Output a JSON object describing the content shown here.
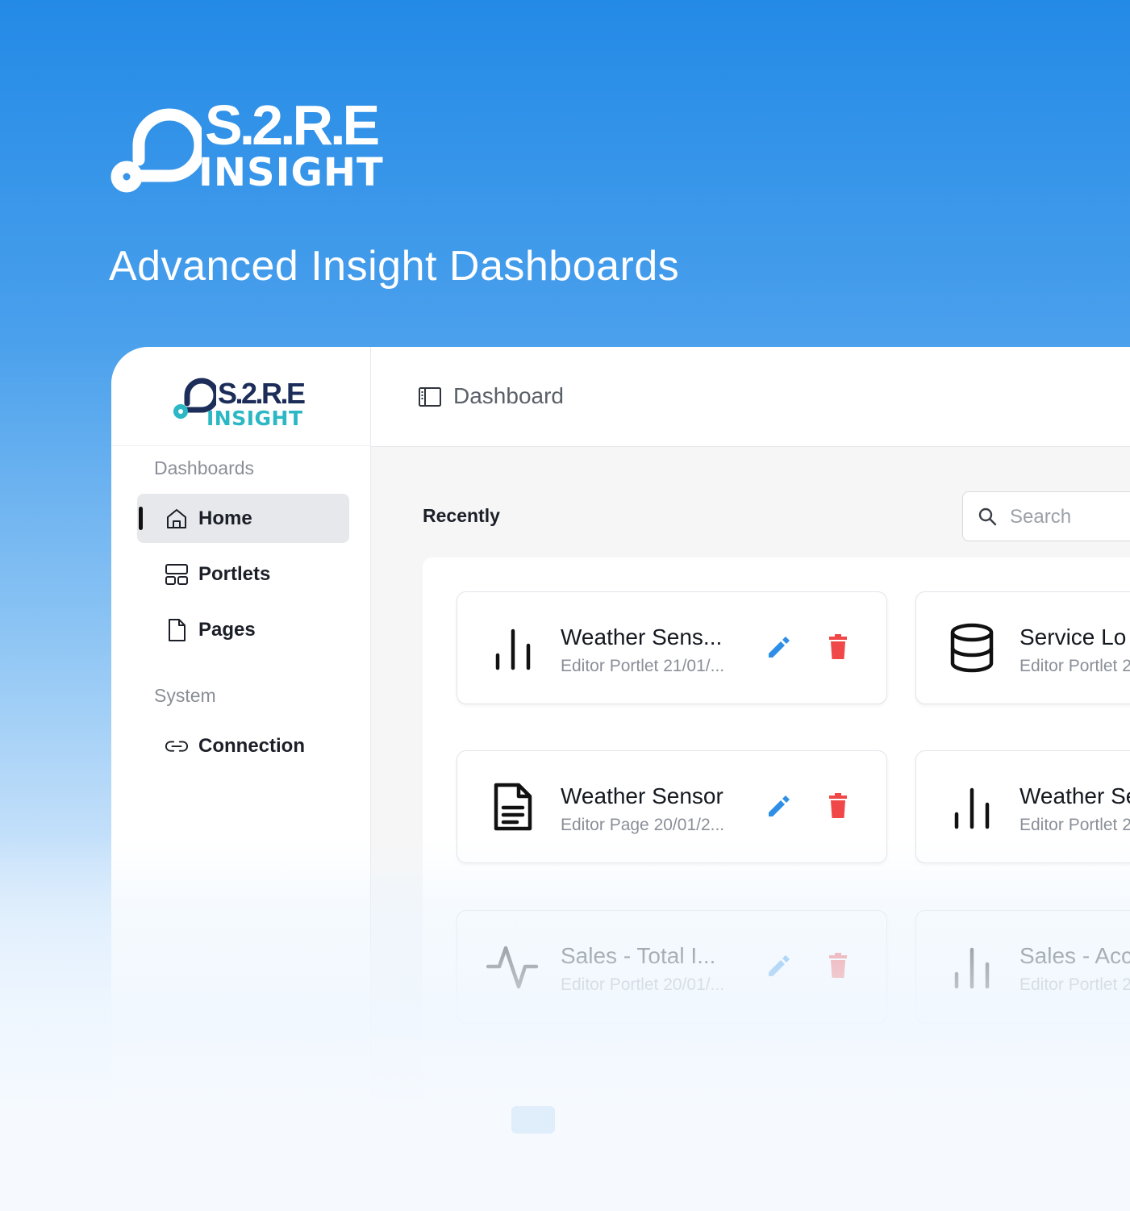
{
  "hero": {
    "brand_top": "S.2.R.E",
    "brand_bottom": "INSIGHT",
    "tagline": "Advanced Insight Dashboards"
  },
  "app": {
    "sidebar": {
      "brand_top": "S.2.R.E",
      "brand_bottom": "INSIGHT",
      "sections": [
        {
          "label": "Dashboards"
        },
        {
          "label": "System"
        }
      ],
      "items": [
        {
          "label": "Home",
          "icon": "home-icon",
          "active": true
        },
        {
          "label": "Portlets",
          "icon": "layout-icon"
        },
        {
          "label": "Pages",
          "icon": "file-icon"
        },
        {
          "label": "Connection",
          "icon": "link-icon"
        }
      ]
    },
    "topbar": {
      "title": "Dashboard",
      "icon": "sidebar-panel-icon"
    },
    "recently_label": "Recently",
    "search": {
      "placeholder": "Search",
      "value": ""
    },
    "cards": [
      {
        "title": "Weather Sens...",
        "subtitle": "Editor Portlet 21/01/...",
        "icon": "bar-chart-icon"
      },
      {
        "title": "Service Lo",
        "subtitle": "Editor Portlet 2",
        "icon": "database-icon"
      },
      {
        "title": "Weather Sensor",
        "subtitle": "Editor Page 20/01/2...",
        "icon": "document-icon"
      },
      {
        "title": "Weather Se",
        "subtitle": "Editor Portlet 2",
        "icon": "bar-chart-icon"
      },
      {
        "title": "Sales - Total I...",
        "subtitle": "Editor Portlet 20/01/...",
        "icon": "activity-icon"
      },
      {
        "title": "Sales - Acc",
        "subtitle": "Editor Portlet 2",
        "icon": "bar-chart-icon"
      }
    ],
    "colors": {
      "edit": "#2f8fe6",
      "delete": "#f04848",
      "accent": "#238ae6",
      "brand_navy": "#1d2d5a",
      "brand_teal": "#2bb7c4"
    }
  }
}
